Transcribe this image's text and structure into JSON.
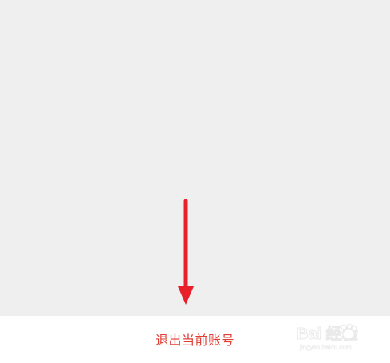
{
  "screen": {
    "background_color": "#efefef",
    "panel_color": "#ffffff"
  },
  "actions": {
    "logout_label": "退出当前账号",
    "label_color": "#e23d35"
  },
  "annotation": {
    "arrow_color": "#e8202a",
    "arrow_icon": "down-arrow-icon"
  },
  "watermark": {
    "text": "Bai 经验",
    "subtext": "jingyan.baidu.com",
    "icon": "paw-icon"
  }
}
